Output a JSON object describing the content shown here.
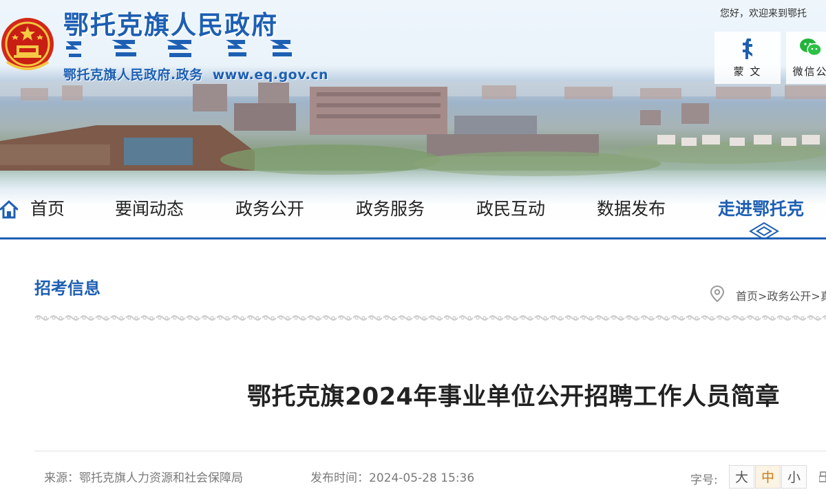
{
  "header": {
    "site_title": "鄂托克旗人民政府",
    "site_subtitle": "鄂托克旗人民政府.政务",
    "site_url": "www.eq.gov.cn",
    "welcome_text": "您好，欢迎来到鄂托",
    "quick_links": [
      {
        "label": "蒙 文",
        "icon": "mongolian-script-icon"
      },
      {
        "label": "微信公",
        "icon": "wechat-icon"
      }
    ]
  },
  "nav": {
    "items": [
      {
        "label": "首页",
        "icon": "home-icon"
      },
      {
        "label": "要闻动态"
      },
      {
        "label": "政务公开"
      },
      {
        "label": "政务服务"
      },
      {
        "label": "政民互动"
      },
      {
        "label": "数据发布"
      },
      {
        "label": "走进鄂托克",
        "active": true
      }
    ]
  },
  "page": {
    "section_title": "招考信息",
    "breadcrumb": "首页>政务公开>真",
    "article_title": "鄂托克旗2024年事业单位公开招聘工作人员简章",
    "source": "来源：鄂托克旗人力资源和社会保障局",
    "publish_time": "发布时间：2024-05-28 15:36",
    "font_size_label": "字号:",
    "font_sizes": [
      {
        "label": "大"
      },
      {
        "label": "中",
        "active": true
      },
      {
        "label": "小"
      }
    ]
  },
  "colors": {
    "brand_blue": "#1d5fb3",
    "active_font_bg": "#fbf3e3",
    "active_font_fg": "#c77a1e"
  }
}
